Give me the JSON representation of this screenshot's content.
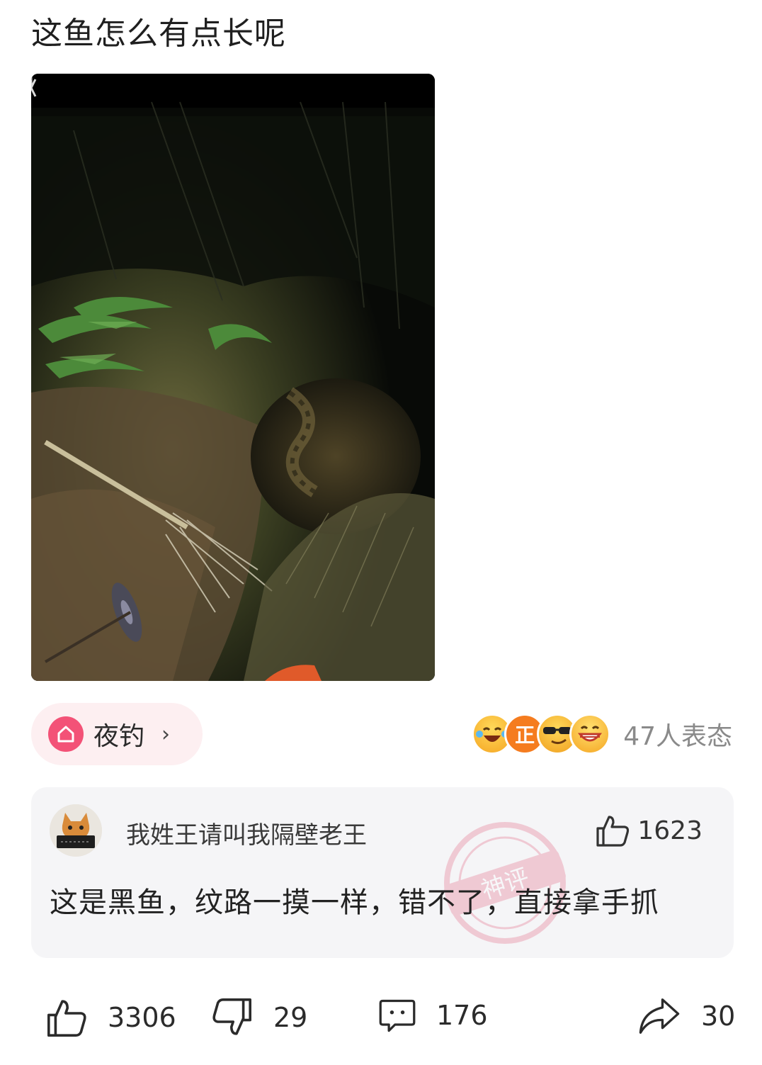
{
  "post": {
    "title": "这鱼怎么有点长呢"
  },
  "topic": {
    "icon": "home-icon",
    "label": "夜钓",
    "chevron": "›"
  },
  "reactions": {
    "emojis": [
      "laugh-cry-emoji",
      "zheng-badge-emoji",
      "sunglasses-emoji",
      "grin-emoji"
    ],
    "count_text": "47人表态"
  },
  "top_comment": {
    "username": "我姓王请叫我隔壁老王",
    "likes": "1623",
    "text": "这是黑鱼，纹路一摸一样，错不了，直接拿手抓",
    "stamp_text": "神评"
  },
  "actions": {
    "likes": "3306",
    "dislikes": "29",
    "comments": "176",
    "shares": "30"
  },
  "colors": {
    "topic_accent": "#f35277",
    "card_bg": "#f5f5f7",
    "muted_text": "#8a8a8a"
  }
}
